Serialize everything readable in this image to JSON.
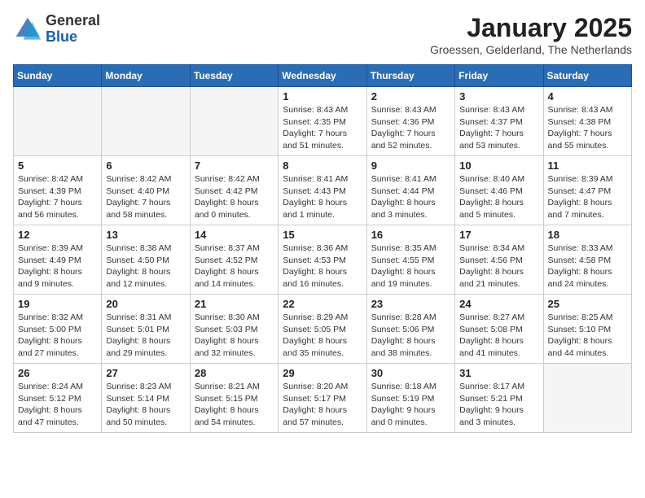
{
  "header": {
    "logo_general": "General",
    "logo_blue": "Blue",
    "month": "January 2025",
    "location": "Groessen, Gelderland, The Netherlands"
  },
  "weekdays": [
    "Sunday",
    "Monday",
    "Tuesday",
    "Wednesday",
    "Thursday",
    "Friday",
    "Saturday"
  ],
  "weeks": [
    [
      {
        "day": "",
        "info": ""
      },
      {
        "day": "",
        "info": ""
      },
      {
        "day": "",
        "info": ""
      },
      {
        "day": "1",
        "info": "Sunrise: 8:43 AM\nSunset: 4:35 PM\nDaylight: 7 hours\nand 51 minutes."
      },
      {
        "day": "2",
        "info": "Sunrise: 8:43 AM\nSunset: 4:36 PM\nDaylight: 7 hours\nand 52 minutes."
      },
      {
        "day": "3",
        "info": "Sunrise: 8:43 AM\nSunset: 4:37 PM\nDaylight: 7 hours\nand 53 minutes."
      },
      {
        "day": "4",
        "info": "Sunrise: 8:43 AM\nSunset: 4:38 PM\nDaylight: 7 hours\nand 55 minutes."
      }
    ],
    [
      {
        "day": "5",
        "info": "Sunrise: 8:42 AM\nSunset: 4:39 PM\nDaylight: 7 hours\nand 56 minutes."
      },
      {
        "day": "6",
        "info": "Sunrise: 8:42 AM\nSunset: 4:40 PM\nDaylight: 7 hours\nand 58 minutes."
      },
      {
        "day": "7",
        "info": "Sunrise: 8:42 AM\nSunset: 4:42 PM\nDaylight: 8 hours\nand 0 minutes."
      },
      {
        "day": "8",
        "info": "Sunrise: 8:41 AM\nSunset: 4:43 PM\nDaylight: 8 hours\nand 1 minute."
      },
      {
        "day": "9",
        "info": "Sunrise: 8:41 AM\nSunset: 4:44 PM\nDaylight: 8 hours\nand 3 minutes."
      },
      {
        "day": "10",
        "info": "Sunrise: 8:40 AM\nSunset: 4:46 PM\nDaylight: 8 hours\nand 5 minutes."
      },
      {
        "day": "11",
        "info": "Sunrise: 8:39 AM\nSunset: 4:47 PM\nDaylight: 8 hours\nand 7 minutes."
      }
    ],
    [
      {
        "day": "12",
        "info": "Sunrise: 8:39 AM\nSunset: 4:49 PM\nDaylight: 8 hours\nand 9 minutes."
      },
      {
        "day": "13",
        "info": "Sunrise: 8:38 AM\nSunset: 4:50 PM\nDaylight: 8 hours\nand 12 minutes."
      },
      {
        "day": "14",
        "info": "Sunrise: 8:37 AM\nSunset: 4:52 PM\nDaylight: 8 hours\nand 14 minutes."
      },
      {
        "day": "15",
        "info": "Sunrise: 8:36 AM\nSunset: 4:53 PM\nDaylight: 8 hours\nand 16 minutes."
      },
      {
        "day": "16",
        "info": "Sunrise: 8:35 AM\nSunset: 4:55 PM\nDaylight: 8 hours\nand 19 minutes."
      },
      {
        "day": "17",
        "info": "Sunrise: 8:34 AM\nSunset: 4:56 PM\nDaylight: 8 hours\nand 21 minutes."
      },
      {
        "day": "18",
        "info": "Sunrise: 8:33 AM\nSunset: 4:58 PM\nDaylight: 8 hours\nand 24 minutes."
      }
    ],
    [
      {
        "day": "19",
        "info": "Sunrise: 8:32 AM\nSunset: 5:00 PM\nDaylight: 8 hours\nand 27 minutes."
      },
      {
        "day": "20",
        "info": "Sunrise: 8:31 AM\nSunset: 5:01 PM\nDaylight: 8 hours\nand 29 minutes."
      },
      {
        "day": "21",
        "info": "Sunrise: 8:30 AM\nSunset: 5:03 PM\nDaylight: 8 hours\nand 32 minutes."
      },
      {
        "day": "22",
        "info": "Sunrise: 8:29 AM\nSunset: 5:05 PM\nDaylight: 8 hours\nand 35 minutes."
      },
      {
        "day": "23",
        "info": "Sunrise: 8:28 AM\nSunset: 5:06 PM\nDaylight: 8 hours\nand 38 minutes."
      },
      {
        "day": "24",
        "info": "Sunrise: 8:27 AM\nSunset: 5:08 PM\nDaylight: 8 hours\nand 41 minutes."
      },
      {
        "day": "25",
        "info": "Sunrise: 8:25 AM\nSunset: 5:10 PM\nDaylight: 8 hours\nand 44 minutes."
      }
    ],
    [
      {
        "day": "26",
        "info": "Sunrise: 8:24 AM\nSunset: 5:12 PM\nDaylight: 8 hours\nand 47 minutes."
      },
      {
        "day": "27",
        "info": "Sunrise: 8:23 AM\nSunset: 5:14 PM\nDaylight: 8 hours\nand 50 minutes."
      },
      {
        "day": "28",
        "info": "Sunrise: 8:21 AM\nSunset: 5:15 PM\nDaylight: 8 hours\nand 54 minutes."
      },
      {
        "day": "29",
        "info": "Sunrise: 8:20 AM\nSunset: 5:17 PM\nDaylight: 8 hours\nand 57 minutes."
      },
      {
        "day": "30",
        "info": "Sunrise: 8:18 AM\nSunset: 5:19 PM\nDaylight: 9 hours\nand 0 minutes."
      },
      {
        "day": "31",
        "info": "Sunrise: 8:17 AM\nSunset: 5:21 PM\nDaylight: 9 hours\nand 3 minutes."
      },
      {
        "day": "",
        "info": ""
      }
    ]
  ]
}
